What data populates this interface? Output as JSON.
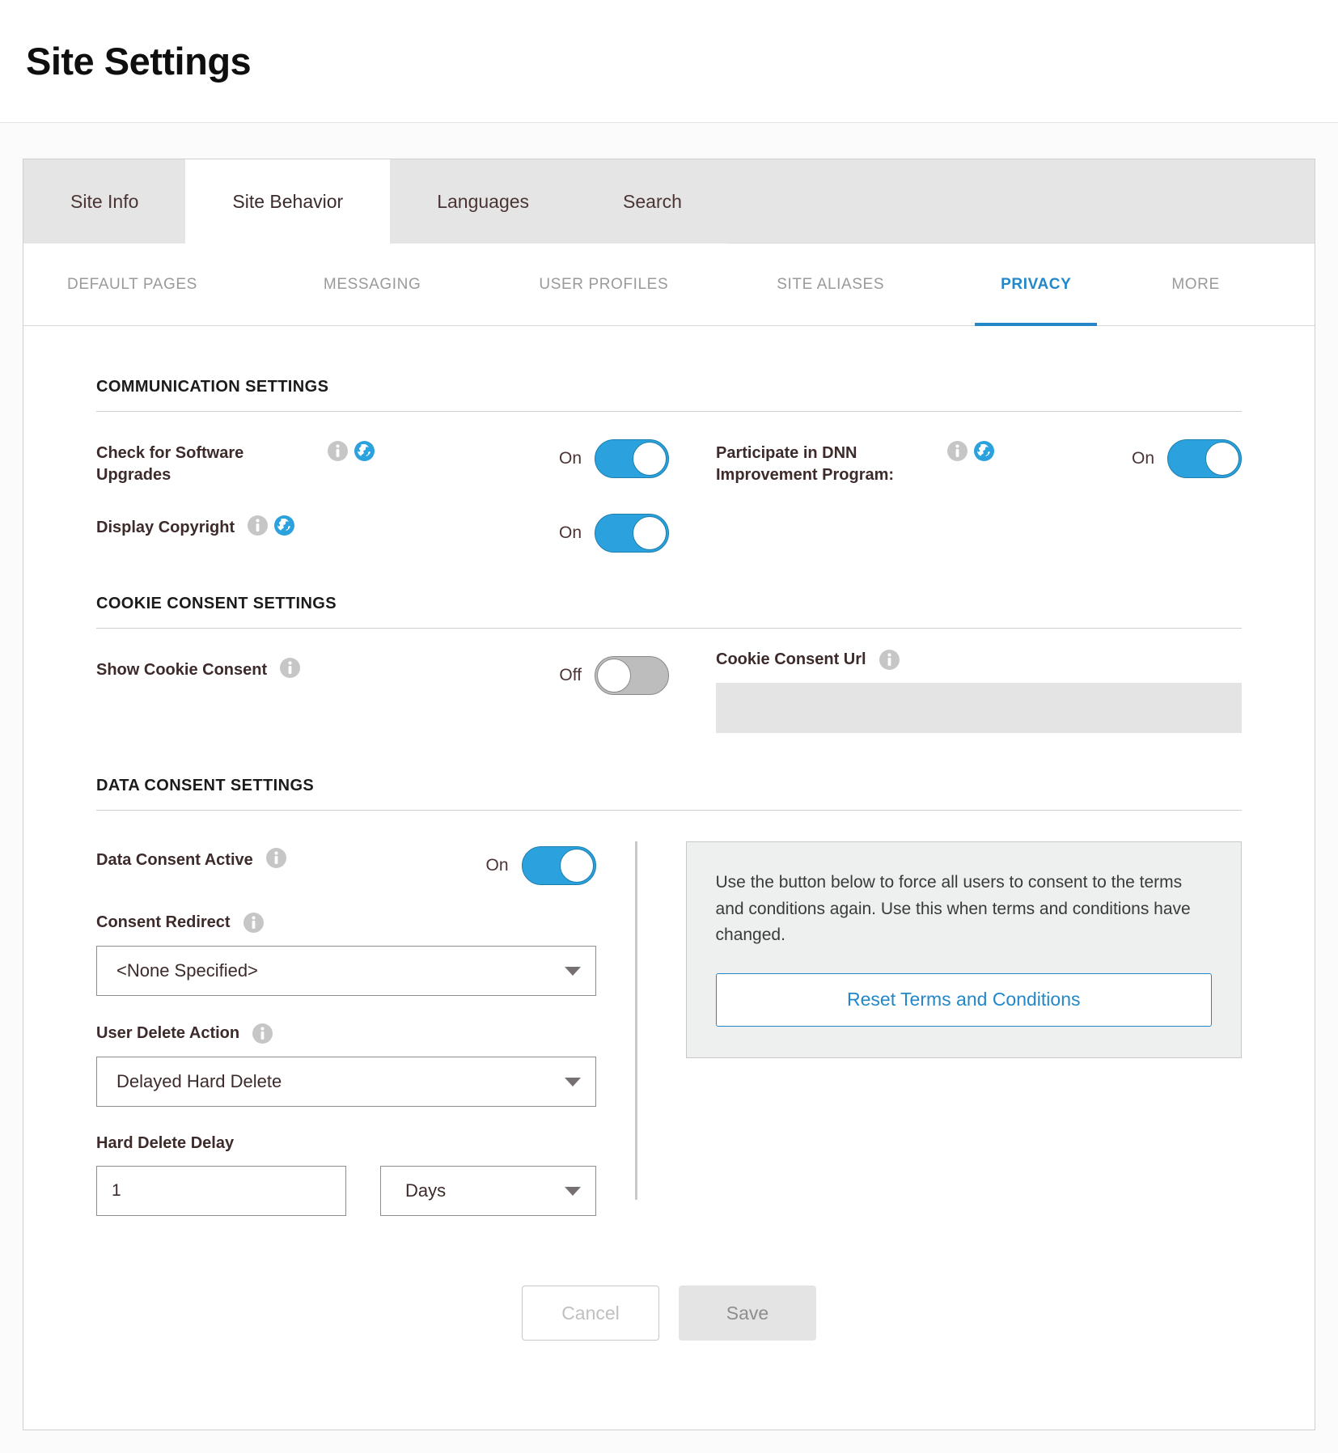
{
  "header": {
    "title": "Site Settings"
  },
  "tabs": [
    {
      "label": "Site Info",
      "active": false
    },
    {
      "label": "Site Behavior",
      "active": true
    },
    {
      "label": "Languages",
      "active": false
    },
    {
      "label": "Search",
      "active": false
    }
  ],
  "subtabs": [
    {
      "label": "DEFAULT PAGES",
      "active": false
    },
    {
      "label": "MESSAGING",
      "active": false
    },
    {
      "label": "USER PROFILES",
      "active": false
    },
    {
      "label": "SITE ALIASES",
      "active": false
    },
    {
      "label": "PRIVACY",
      "active": true
    },
    {
      "label": "MORE",
      "active": false
    }
  ],
  "communication": {
    "section_title": "COMMUNICATION SETTINGS",
    "check_upgrades": {
      "label": "Check for Software Upgrades",
      "state_label": "On",
      "state": "on",
      "icons": [
        "info-icon",
        "globe-icon"
      ]
    },
    "dnn_program": {
      "label": "Participate in DNN Improvement Program:",
      "state_label": "On",
      "state": "on",
      "icons": [
        "info-icon",
        "globe-icon"
      ]
    },
    "display_copyright": {
      "label": "Display Copyright",
      "state_label": "On",
      "state": "on",
      "icons": [
        "info-icon",
        "globe-icon"
      ]
    }
  },
  "cookie_consent": {
    "section_title": "COOKIE CONSENT SETTINGS",
    "show_cookie_consent": {
      "label": "Show Cookie Consent",
      "state_label": "Off",
      "state": "off",
      "icons": [
        "info-icon"
      ]
    },
    "cookie_consent_url": {
      "label": "Cookie Consent Url",
      "value": "",
      "disabled": true,
      "icons": [
        "info-icon"
      ]
    }
  },
  "data_consent": {
    "section_title": "DATA CONSENT SETTINGS",
    "data_consent_active": {
      "label": "Data Consent Active",
      "state_label": "On",
      "state": "on",
      "icons": [
        "info-icon"
      ]
    },
    "consent_redirect": {
      "label": "Consent Redirect",
      "value": "<None Specified>",
      "icons": [
        "info-icon"
      ]
    },
    "user_delete_action": {
      "label": "User Delete Action",
      "value": "Delayed Hard Delete",
      "icons": [
        "info-icon"
      ]
    },
    "hard_delete_delay": {
      "label": "Hard Delete Delay",
      "value": "1",
      "unit": "Days"
    },
    "reset_panel": {
      "text": "Use the button below to force all users to consent to the terms and conditions again. Use this when terms and conditions have changed.",
      "button_label": "Reset Terms and Conditions"
    }
  },
  "footer": {
    "cancel_label": "Cancel",
    "save_label": "Save"
  },
  "colors": {
    "accent": "#2387c8",
    "toggle_on": "#2ba2dd",
    "toggle_off": "#bdbdbd",
    "label": "#3d2b2b"
  }
}
